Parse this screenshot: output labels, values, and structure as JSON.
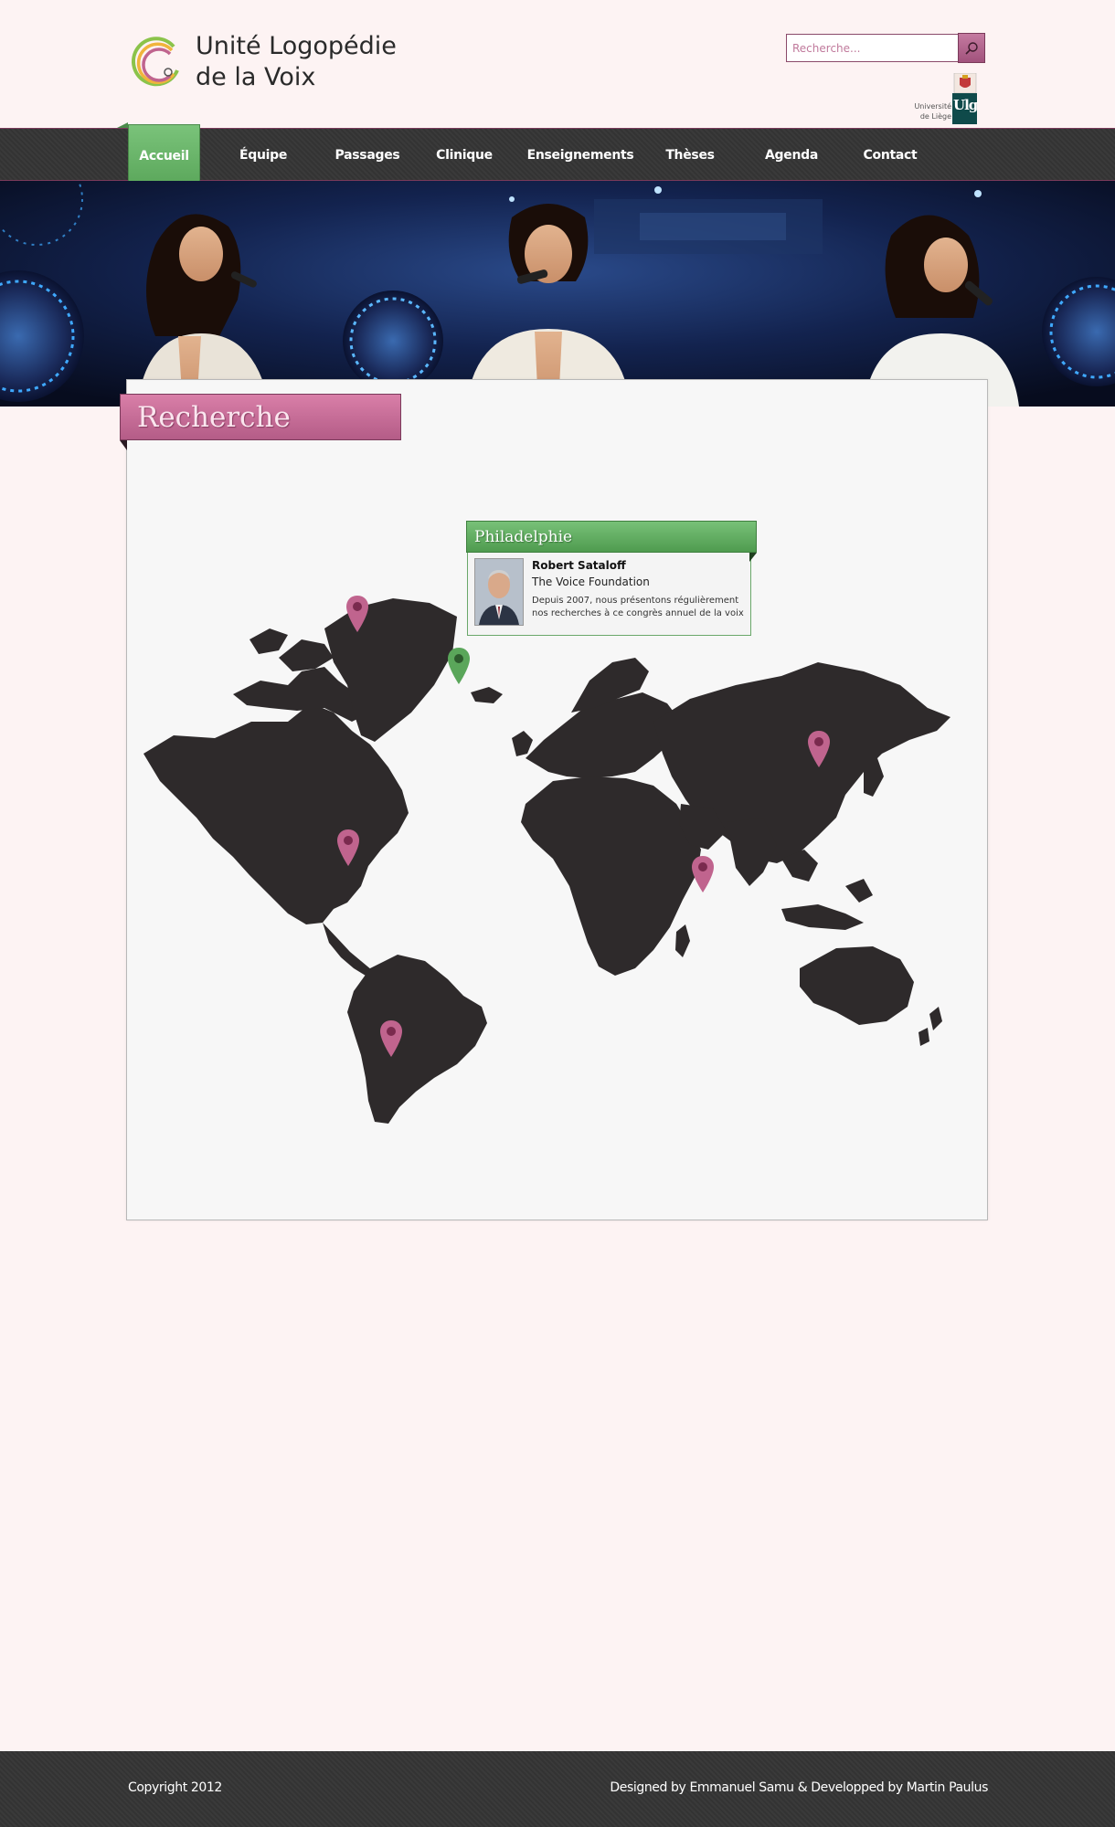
{
  "header": {
    "logo_line1": "Unité Logopédie",
    "logo_line2": "de la Voix",
    "search_placeholder": "Recherche...",
    "university_line1": "Université",
    "university_line2": "de Liège",
    "university_logo_letters": "Ulg"
  },
  "nav": {
    "items": [
      {
        "label": "Accueil",
        "active": true
      },
      {
        "label": "Équipe",
        "active": false
      },
      {
        "label": "Passages",
        "active": false
      },
      {
        "label": "Clinique",
        "active": false
      },
      {
        "label": "Enseignements",
        "active": false
      },
      {
        "label": "Thèses",
        "active": false
      },
      {
        "label": "Agenda",
        "active": false
      },
      {
        "label": "Contact",
        "active": false
      }
    ]
  },
  "page": {
    "title": "Recherche"
  },
  "popup": {
    "city": "Philadelphie",
    "name": "Robert Sataloff",
    "organization": "The Voice Foundation",
    "description": "Depuis 2007, nous présentons régulièrement nos recherches à ce congrès annuel de la voix"
  },
  "pins": [
    {
      "color": "pink"
    },
    {
      "color": "green"
    },
    {
      "color": "pink"
    },
    {
      "color": "pink"
    },
    {
      "color": "pink"
    },
    {
      "color": "pink"
    }
  ],
  "colors": {
    "accent_pink": "#c0648e",
    "accent_green": "#5aa65a",
    "nav_dark": "#363636",
    "page_bg": "#fdf3f3",
    "continent": "#2e2a2b"
  },
  "footer": {
    "copyright": "Copyright 2012",
    "credits": "Designed by Emmanuel Samu & Developped by Martin Paulus"
  }
}
